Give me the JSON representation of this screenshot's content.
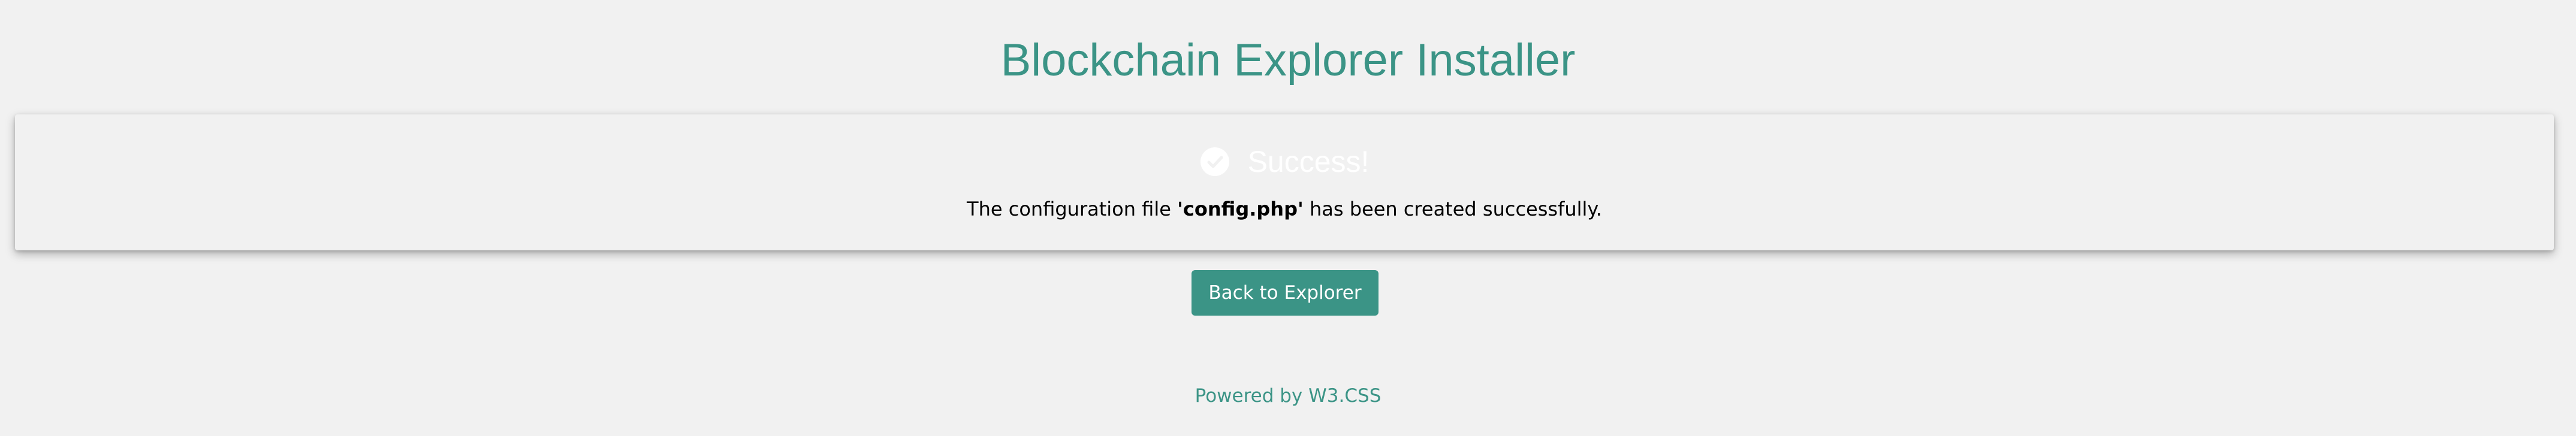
{
  "header": {
    "title": "Blockchain Explorer Installer"
  },
  "alert": {
    "icon": "check-circle-icon",
    "title": "Success!",
    "message_prefix": "The configuration file ",
    "message_file": "'config.php'",
    "message_suffix": " has been created successfully."
  },
  "actions": {
    "back_label": "Back to Explorer"
  },
  "footer": {
    "text": "Powered by W3.CSS"
  },
  "colors": {
    "accent": "#3b9486",
    "background": "#f1f1f1",
    "button_text": "#ffffff"
  }
}
